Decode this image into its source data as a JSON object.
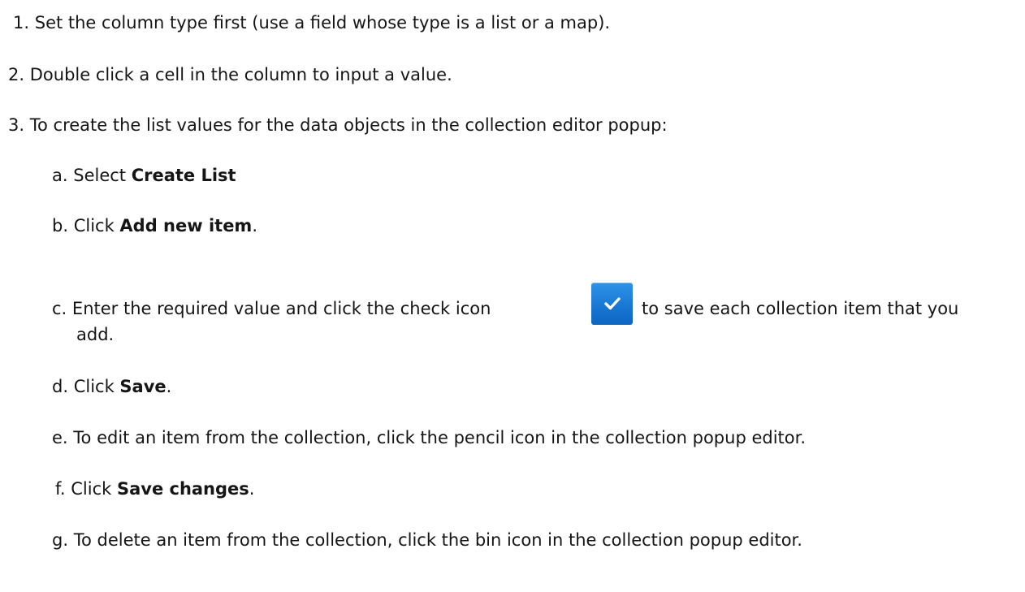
{
  "steps": [
    {
      "marker": "1.",
      "text": "Set the column type first (use a field whose type is a list or a map)."
    },
    {
      "marker": "2.",
      "text": "Double click a cell in the column to input a value."
    },
    {
      "marker": "3.",
      "text": "To create the list values for the data objects in the collection editor popup:"
    }
  ],
  "substeps": [
    {
      "marker": "a.",
      "before": "Select ",
      "bold": "Create List",
      "after": ""
    },
    {
      "marker": "b.",
      "before": "Click ",
      "bold": "Add new item",
      "after": "."
    },
    {
      "marker": "c.",
      "before": "Enter the required value and click the check icon",
      "after": "to save each collection item that you",
      "continuation": "add."
    },
    {
      "marker": "d.",
      "before": "Click ",
      "bold": "Save",
      "after": "."
    },
    {
      "marker": "e.",
      "before": "To edit an item from the collection, click the pencil icon in the collection popup editor."
    },
    {
      "marker": "f.",
      "before": "Click ",
      "bold": "Save changes",
      "after": "."
    },
    {
      "marker": "g.",
      "before": "To delete an item from the collection, click the bin icon in the collection popup editor."
    }
  ],
  "icons": {
    "inline_check": "check-icon",
    "inline_check_color": "#1676d2"
  }
}
